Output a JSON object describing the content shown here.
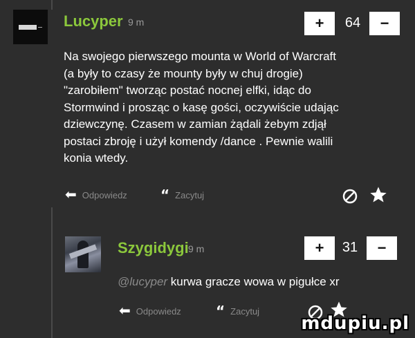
{
  "comments": [
    {
      "username": "Lucyper",
      "time": "9 m",
      "plus": "+",
      "score": "64",
      "minus": "−",
      "lines": [
        "Na swojego pierwszego mounta w World of Warcraft",
        "(a były to czasy że mounty były w chuj drogie)",
        "\"zarobiłem\" tworząc postać nocnej elfki, idąc do",
        "Stormwind i prosząc o kasę gości, oczywiście udając",
        "dziewczynę. Czasem w zamian żądali żebym zdjął",
        "postaci zbroję i użył komendy /dance . Pewnie walili",
        "konia wtedy."
      ],
      "reply_label": "Odpowiedz",
      "quote_label": "Zacytuj"
    },
    {
      "username": "Szygidygi",
      "time": "9 m",
      "plus": "+",
      "score": "31",
      "minus": "−",
      "mention": "@lucyper",
      "text": " kurwa gracze wowa w pigułce xr",
      "reply_label": "Odpowiedz",
      "quote_label": "Zacytuj"
    }
  ],
  "icons": {
    "reply": "reply-arrow-icon",
    "quote": "quote-icon",
    "block": "block-icon",
    "favorite": "star-icon"
  },
  "watermark": "mdupiu.pl",
  "colors": {
    "username": "#8cc83c",
    "background": "#2d2d2d",
    "muted": "#8a8a8a"
  }
}
